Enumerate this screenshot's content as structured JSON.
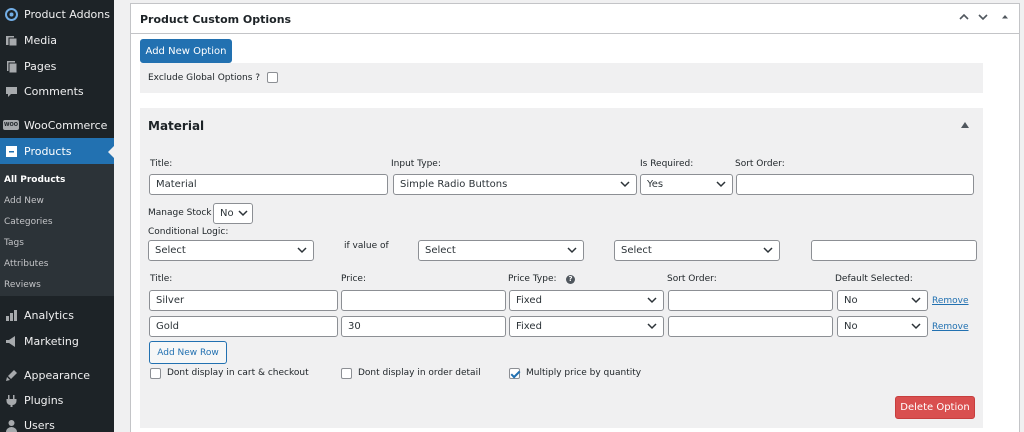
{
  "sidebar": {
    "items": [
      {
        "label": "Product Addons",
        "icon": "addons-icon"
      },
      {
        "label": "Media",
        "icon": "media-icon"
      },
      {
        "label": "Pages",
        "icon": "pages-icon"
      },
      {
        "label": "Comments",
        "icon": "comments-icon"
      },
      {
        "label": "WooCommerce",
        "icon": "woocommerce-icon",
        "icon_text": "WOO"
      },
      {
        "label": "Products",
        "icon": "products-icon"
      },
      {
        "label": "Analytics",
        "icon": "analytics-icon"
      },
      {
        "label": "Marketing",
        "icon": "marketing-icon"
      },
      {
        "label": "Appearance",
        "icon": "appearance-icon"
      },
      {
        "label": "Plugins",
        "icon": "plugins-icon"
      },
      {
        "label": "Users",
        "icon": "users-icon"
      }
    ],
    "submenu": [
      "All Products",
      "Add New",
      "Categories",
      "Tags",
      "Attributes",
      "Reviews"
    ]
  },
  "panel": {
    "title": "Product Custom Options",
    "add_new_option": "Add New Option",
    "exclude_global_label": "Exclude Global Options ?",
    "option": {
      "name": "Material",
      "labels": {
        "title": "Title:",
        "input_type": "Input Type:",
        "is_required": "Is Required:",
        "sort_order": "Sort Order:",
        "manage_stock": "Manage Stock",
        "conditional_logic": "Conditional Logic:",
        "if_value_of": "if value of"
      },
      "values": {
        "title": "Material",
        "input_type": "Simple Radio Buttons",
        "is_required": "Yes",
        "sort_order": "",
        "manage_stock": "No",
        "cond_1": "Select",
        "cond_2": "Select",
        "cond_3": "Select",
        "cond_value": ""
      },
      "row_headers": [
        "Title:",
        "Price:",
        "Price Type:",
        "Sort Order:",
        "Default Selected:"
      ],
      "rows": [
        {
          "title": "Silver",
          "price": "",
          "price_type": "Fixed",
          "sort_order": "",
          "default_selected": "No",
          "remove": "Remove"
        },
        {
          "title": "Gold",
          "price": "30",
          "price_type": "Fixed",
          "sort_order": "",
          "default_selected": "No",
          "remove": "Remove"
        }
      ],
      "add_new_row": "Add New Row",
      "checkboxes": [
        {
          "label": "Dont display in cart & checkout",
          "checked": false
        },
        {
          "label": "Dont display in order detail",
          "checked": false
        },
        {
          "label": "Multiply price by quantity",
          "checked": true
        }
      ],
      "delete_option": "Delete Option"
    }
  }
}
